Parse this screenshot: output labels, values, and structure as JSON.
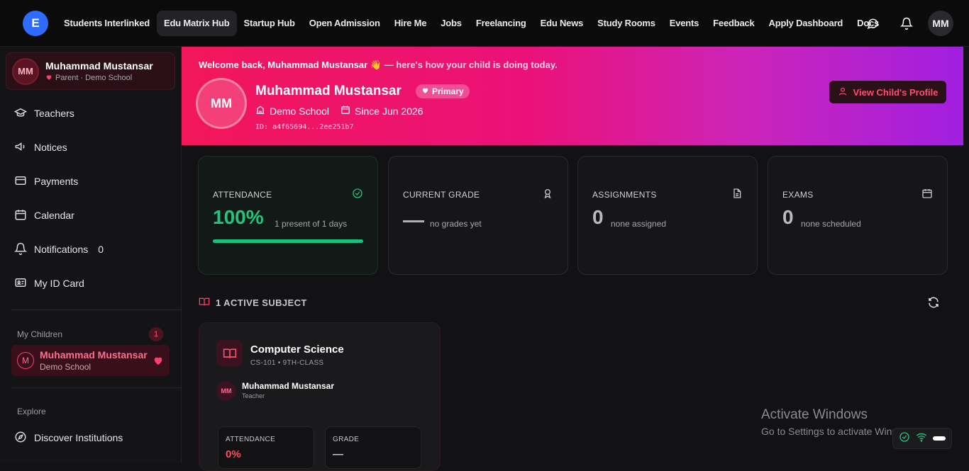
{
  "topbar": {
    "logo": "E",
    "nav": [
      "Students Interlinked",
      "Edu Matrix Hub",
      "Startup Hub",
      "Open Admission",
      "Hire Me",
      "Jobs",
      "Freelancing",
      "Edu News",
      "Study Rooms",
      "Events",
      "Feedback",
      "Apply Dashboard",
      "Docs"
    ],
    "active_index": 1,
    "icons": [
      "chat-icon",
      "bell-icon"
    ],
    "avatar": "MM"
  },
  "sidebar": {
    "user": {
      "initials": "MM",
      "name": "Muhammad Mustansar",
      "role": "Parent · Demo School"
    },
    "items": [
      {
        "label": "Teachers",
        "icon": "users-icon"
      },
      {
        "label": "Notices",
        "icon": "megaphone-icon"
      },
      {
        "label": "Payments",
        "icon": "credit-card-icon"
      },
      {
        "label": "Calendar",
        "icon": "calendar-icon"
      },
      {
        "label": "Notifications",
        "icon": "bell-icon",
        "count": "0"
      },
      {
        "label": "My ID Card",
        "icon": "id-card-icon"
      }
    ],
    "children_title": "My Children",
    "children_count": "1",
    "child": {
      "initial": "M",
      "name": "Muhammad Mustansar",
      "school": "Demo School"
    },
    "explore_title": "Explore",
    "explore_items": [
      {
        "label": "Discover Institutions",
        "icon": "compass-icon"
      }
    ]
  },
  "hero": {
    "welcome": "Welcome back, Muhammad Mustansar 👋",
    "welcome_tail": "— here's how your child is doing today.",
    "initials": "MM",
    "name": "Muhammad Mustansar",
    "badge": "Primary",
    "school": "Demo School",
    "since": "Since Jun 2026",
    "id": "ID: a4f65694...2ee251b7",
    "button": "View Child's Profile"
  },
  "stats": {
    "attendance": {
      "label": "ATTENDANCE",
      "value": "100%",
      "sub": "1 present of 1 days",
      "progress": 100
    },
    "grade": {
      "label": "CURRENT GRADE",
      "sub": "no grades yet"
    },
    "assignments": {
      "label": "ASSIGNMENTS",
      "value": "0",
      "sub": "none assigned"
    },
    "exams": {
      "label": "EXAMS",
      "value": "0",
      "sub": "none scheduled"
    }
  },
  "subjects": {
    "heading": "1 ACTIVE SUBJECT",
    "card": {
      "title": "Computer Science",
      "code": "CS-101 • 9TH-CLASS",
      "teacher_initials": "MM",
      "teacher_name": "Muhammad Mustansar",
      "teacher_role": "Teacher",
      "attendance_label": "ATTENDANCE",
      "attendance_value": "0%",
      "grade_label": "GRADE",
      "grade_value": "—"
    }
  },
  "watermark": {
    "line1": "Activate Windows",
    "line2": "Go to Settings to activate Windows."
  },
  "colors": {
    "accent": "#f2165a",
    "purple": "#a11fe0",
    "green": "#19c27c"
  }
}
